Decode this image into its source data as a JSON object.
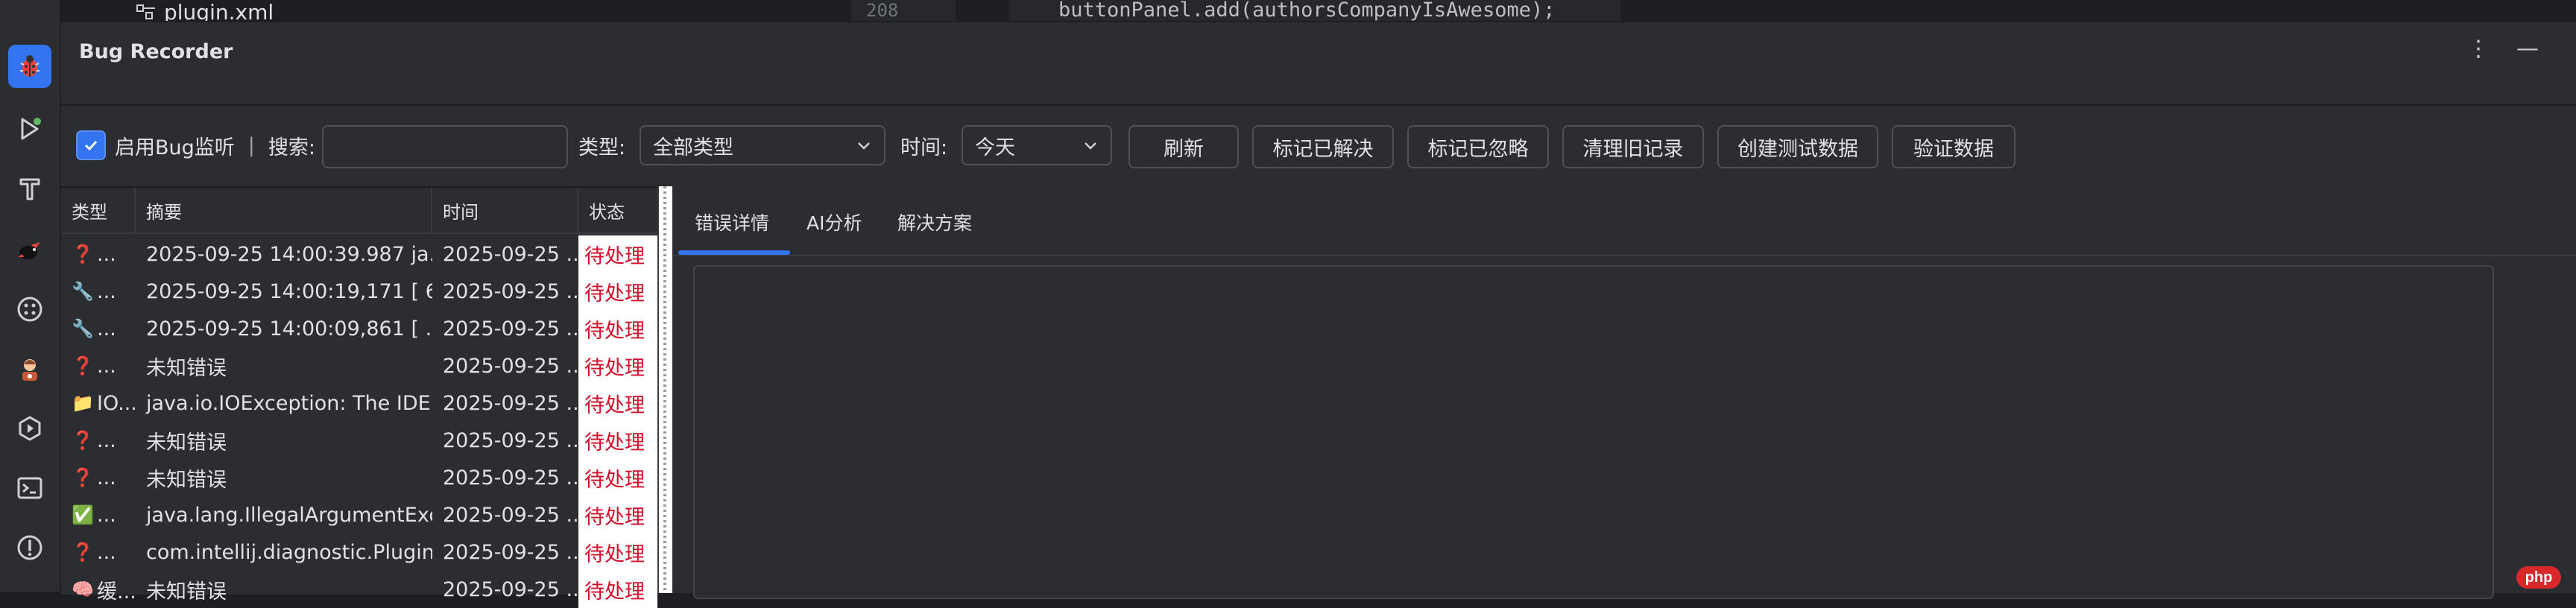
{
  "editor": {
    "file_name": "plugin.xml",
    "line_number": "208",
    "code_line": "buttonPanel.add(authorsCompanyIsAwesome);"
  },
  "window": {
    "title": "Bug Recorder",
    "more_icon": "⋮",
    "minimize_icon": "—"
  },
  "toolbar": {
    "enable_label": "启用Bug监听",
    "separator": "|",
    "search_label": "搜索:",
    "search_value": "",
    "type_label": "类型:",
    "type_value": "全部类型",
    "time_label": "时间:",
    "time_value": "今天",
    "refresh": "刷新",
    "mark_resolved": "标记已解决",
    "mark_ignored": "标记已忽略",
    "clear_old": "清理旧记录",
    "create_test": "创建测试数据",
    "verify": "验证数据"
  },
  "table": {
    "headers": [
      "类型",
      "摘要",
      "时间",
      "状态"
    ],
    "rows": [
      {
        "icon": "❓",
        "type": "...",
        "summary": "2025-09-25 14:00:39.987 ja...",
        "time": "2025-09-25 ...",
        "status": "待处理"
      },
      {
        "icon": "🔧",
        "type": "...",
        "summary": "2025-09-25 14:00:19,171 [  6...",
        "time": "2025-09-25 ...",
        "status": "待处理"
      },
      {
        "icon": "🔧",
        "type": "...",
        "summary": "2025-09-25 14:00:09,861 [  ...",
        "time": "2025-09-25 ...",
        "status": "待处理"
      },
      {
        "icon": "❓",
        "type": "...",
        "summary": "未知错误",
        "time": "2025-09-25 ...",
        "status": "待处理"
      },
      {
        "icon": "📁",
        "type": "IO...",
        "summary": "java.io.IOException: The IDE i...",
        "time": "2025-09-25 ...",
        "status": "待处理"
      },
      {
        "icon": "❓",
        "type": "...",
        "summary": "未知错误",
        "time": "2025-09-25 ...",
        "status": "待处理"
      },
      {
        "icon": "❓",
        "type": "...",
        "summary": "未知错误",
        "time": "2025-09-25 ...",
        "status": "待处理"
      },
      {
        "icon": "✅",
        "type": "...",
        "summary": "java.lang.IllegalArgumentExc...",
        "time": "2025-09-25 ...",
        "status": "待处理"
      },
      {
        "icon": "❓",
        "type": "...",
        "summary": "com.intellij.diagnostic.Plugin...",
        "time": "2025-09-25 ...",
        "status": "待处理"
      },
      {
        "icon": "🧠",
        "type": "缓...",
        "summary": "未知错误",
        "time": "2025-09-25 ...",
        "status": "待处理"
      }
    ]
  },
  "detail_tabs": [
    "错误详情",
    "AI分析",
    "解决方案"
  ],
  "watermark": "php",
  "colors": {
    "accent": "#3574f0",
    "status_pending": "#d0112b",
    "panel": "#2b2d30"
  },
  "icons": [
    "bug-icon",
    "run-icon",
    "build-icon",
    "bird-icon",
    "plugins-icon",
    "avatar-icon",
    "services-icon",
    "terminal-icon",
    "problems-icon"
  ]
}
